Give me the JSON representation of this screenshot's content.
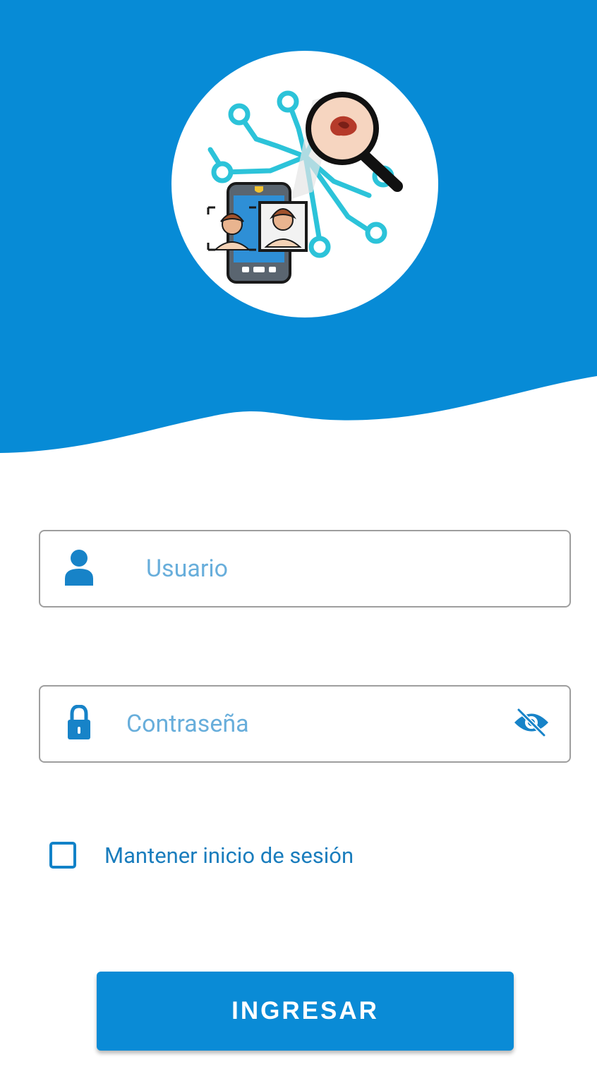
{
  "colors": {
    "primary": "#078bd6",
    "placeholder": "#68aedb",
    "border": "#9e9e9e",
    "checkbox": "#1282c8",
    "background": "#ffffff"
  },
  "header": {
    "logo_icon": "face-recognition-skin-analysis-logo"
  },
  "username_field": {
    "icon": "person-icon",
    "placeholder": "Usuario",
    "value": ""
  },
  "password_field": {
    "icon": "lock-icon",
    "placeholder": "Contraseña",
    "value": "",
    "toggle_icon": "eye-off-icon"
  },
  "remember": {
    "label": "Mantener inicio de sesión",
    "checked": false
  },
  "submit": {
    "label": "INGRESAR"
  }
}
